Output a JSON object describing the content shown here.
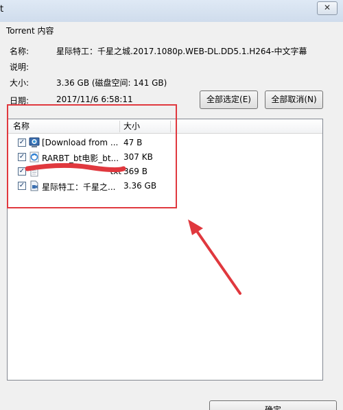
{
  "window": {
    "title": "t",
    "close_label": "✕"
  },
  "group": {
    "label": "Torrent 内容"
  },
  "info": {
    "name_label": "名称:",
    "name_value": "星际特工：千星之城.2017.1080p.WEB-DL.DD5.1.H264-中文字幕",
    "desc_label": "说明:",
    "size_label": "大小:",
    "size_value": "3.36 GB (磁盘空间: 141 GB)",
    "date_label": "日期:",
    "date_value": "2017/11/6 6:58:11"
  },
  "buttons": {
    "select_all": "全部选定(E)",
    "deselect_all": "全部取消(N)",
    "ok": "确定"
  },
  "file_list": {
    "columns": [
      "名称",
      "大小"
    ],
    "rows": [
      {
        "name": "[Download from ...",
        "size": "47 B",
        "checked": true,
        "icon": "web-page-icon"
      },
      {
        "name": "RARBT_bt电影_bt...",
        "size": "307 KB",
        "checked": true,
        "icon": "url-shortcut-icon"
      },
      {
        "name": "txt",
        "size": "369 B",
        "checked": true,
        "icon": "text-file-icon"
      },
      {
        "name": "星际特工：千星之...",
        "size": "3.36 GB",
        "checked": true,
        "icon": "video-file-icon"
      }
    ]
  },
  "colors": {
    "annotation": "#e0383e",
    "window_bg": "#f0f0f0"
  }
}
